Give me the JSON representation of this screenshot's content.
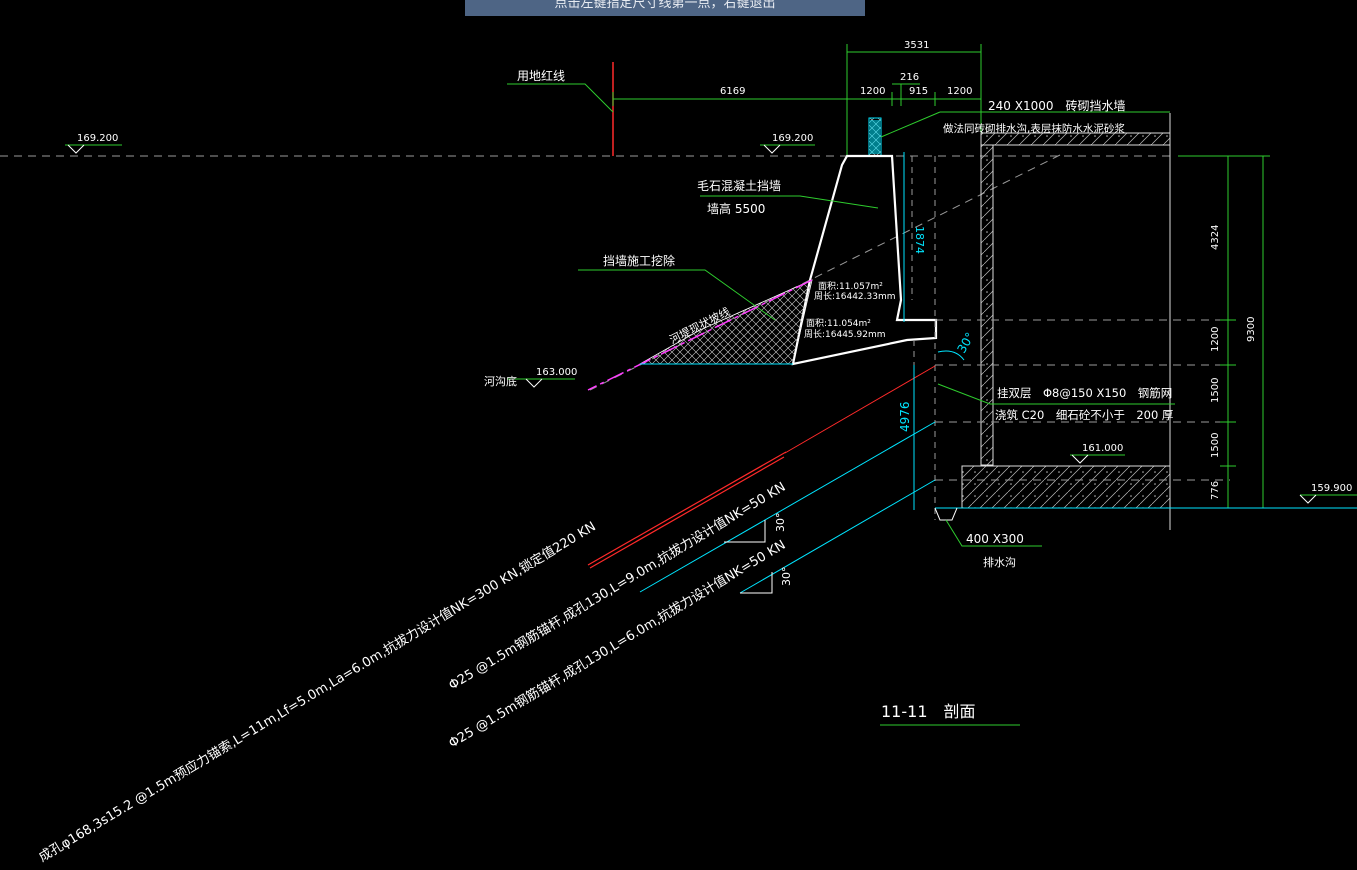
{
  "prompt": {
    "text": "点击左键指定尺寸线第一点，右键退出"
  },
  "drawing": {
    "title": "11-11　剖面",
    "dims": {
      "total_top": "3531",
      "left_span": "6169",
      "seg1": "1200",
      "seg2": "216",
      "seg3": "915",
      "seg4": "1200",
      "wall_h": "1874",
      "anchor_len": "4976",
      "right_1": "4324",
      "right_2": "1200",
      "right_3": "1500",
      "right_4": "1500",
      "right_5": "776",
      "right_total": "9300"
    },
    "elevations": {
      "e1": "169.200",
      "e2": "169.200",
      "e3": "163.000",
      "e4": "161.000",
      "e5": "159.900"
    },
    "labels": {
      "red_line": "用地红线",
      "brick_wall": "240 X1000　砖砌挡水墙",
      "brick_note": "做法同砖砌排水沟,表层抹防水水泥砂浆",
      "rubble_wall": "毛石混凝土挡墙",
      "wall_height": "墙高 5500",
      "excavation": "挡墙施工挖除",
      "riverbank": "河堤现状坡线",
      "river_bottom": "河沟底",
      "area1": "面积:11.057m²",
      "perim1": "周长:16442.33mm",
      "area2": "面积:11.054m²",
      "perim2": "周长:16445.92mm",
      "mesh": "挂双层　Φ8@150 X150　钢筋网",
      "shotcrete": "浇筑 C20　细石砼不小于　200 厚",
      "drain_size": "400 X300",
      "drain": "排水沟",
      "angle_top": "30°",
      "angle_mid": "30°",
      "angle_low": "30°"
    },
    "anchors": {
      "a1": "成孔φ168,3s15.2 @1.5m预应力锚索,L=11m,Lf=5.0m,La=6.0m,抗拔力设计值NK=300 KN,锁定值220 KN",
      "a2": "Φ25 @1.5m钢筋锚杆,成孔130,L=9.0m,抗拔力设计值NK=50 KN",
      "a3": "Φ25 @1.5m钢筋锚杆,成孔130,L=6.0m,抗拔力设计值NK=50 KN"
    },
    "colors": {
      "background": "#000000",
      "green": "#2ecc2e",
      "white": "#ffffff",
      "cyan": "#00e5ff",
      "red": "#ff2a2a",
      "magenta": "#ff3cff",
      "gray": "#9a9a9a",
      "tip_bg": "#4e6585"
    }
  }
}
